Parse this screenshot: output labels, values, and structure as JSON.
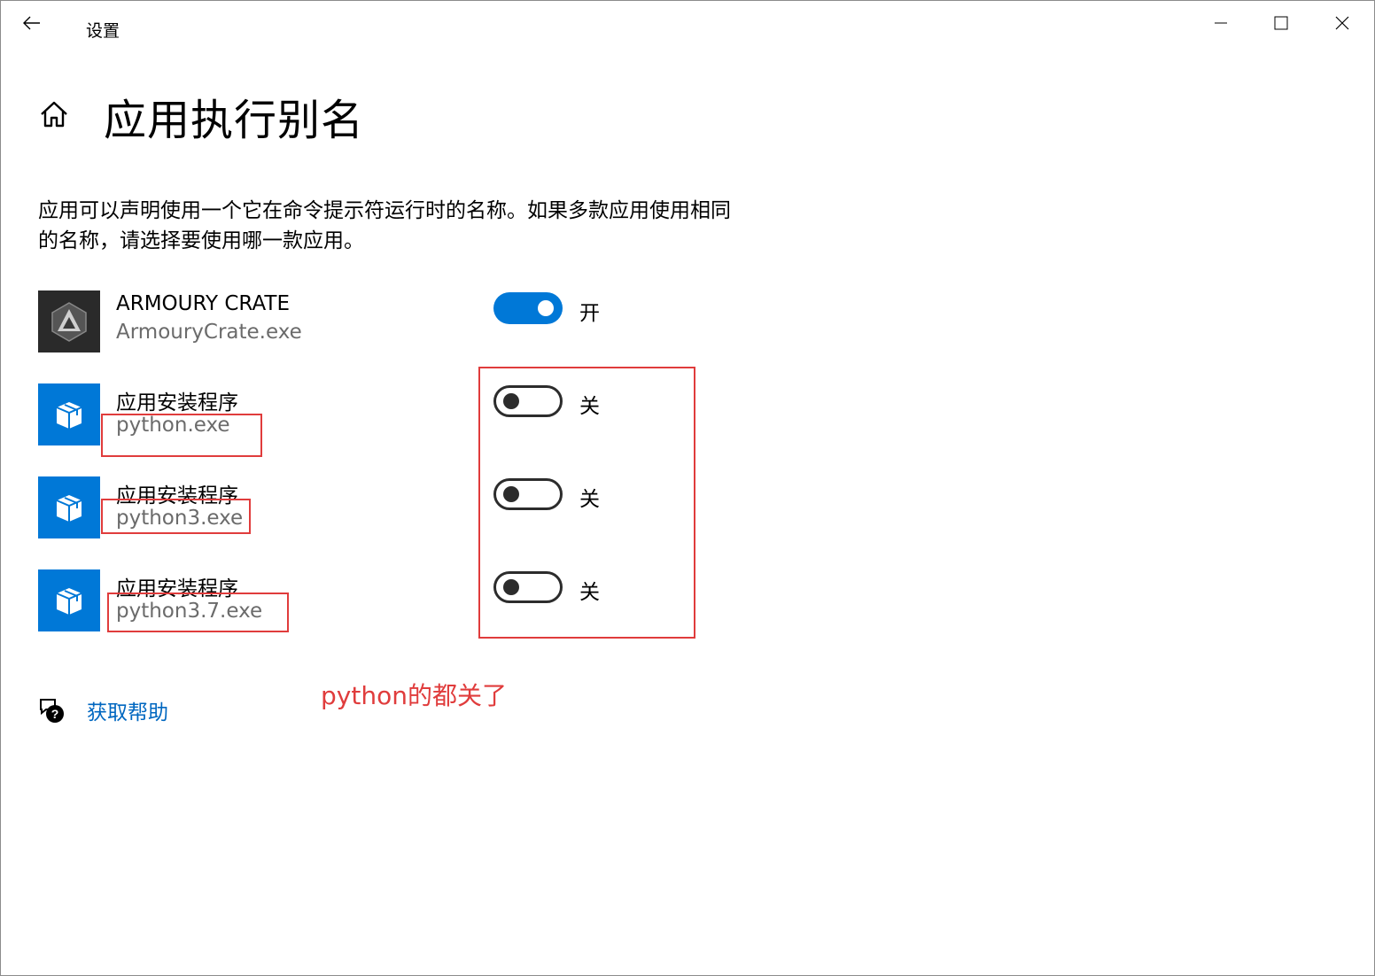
{
  "window": {
    "title": "设置"
  },
  "page": {
    "title": "应用执行别名",
    "description": "应用可以声明使用一个它在命令提示符运行时的名称。如果多款应用使用相同的名称，请选择要使用哪一款应用。"
  },
  "apps": [
    {
      "name": "ARMOURY CRATE",
      "exe": "ArmouryCrate.exe",
      "state_label": "开",
      "enabled": true,
      "icon": "armoury-crate-logo"
    },
    {
      "name": "应用安装程序",
      "exe": "python.exe",
      "state_label": "关",
      "enabled": false,
      "icon": "app-installer-box-icon"
    },
    {
      "name": "应用安装程序",
      "exe": "python3.exe",
      "state_label": "关",
      "enabled": false,
      "icon": "app-installer-box-icon"
    },
    {
      "name": "应用安装程序",
      "exe": "python3.7.exe",
      "state_label": "关",
      "enabled": false,
      "icon": "app-installer-box-icon"
    }
  ],
  "help": {
    "label": "获取帮助"
  },
  "annotation": {
    "text": "python的都关了",
    "color": "#e03c3c"
  },
  "colors": {
    "accent": "#0078d7",
    "link": "#0067c0",
    "annotation": "#e03c3c"
  }
}
